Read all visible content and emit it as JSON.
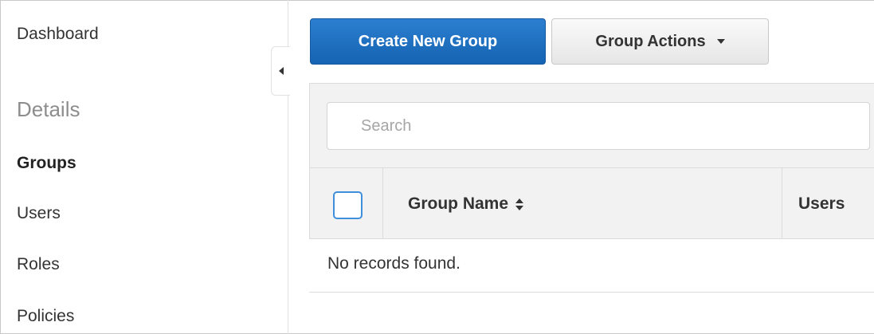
{
  "sidebar": {
    "dashboard": "Dashboard",
    "section_title": "Details",
    "items": [
      {
        "label": "Groups",
        "active": true
      },
      {
        "label": "Users",
        "active": false
      },
      {
        "label": "Roles",
        "active": false
      },
      {
        "label": "Policies",
        "active": false
      }
    ]
  },
  "toolbar": {
    "create_label": "Create New Group",
    "actions_label": "Group Actions"
  },
  "search": {
    "placeholder": "Search"
  },
  "table": {
    "columns": [
      "Group Name",
      "Users"
    ],
    "empty_message": "No records found."
  },
  "colors": {
    "primary": "#1f72c4",
    "checkbox_border": "#3f8fdc"
  }
}
